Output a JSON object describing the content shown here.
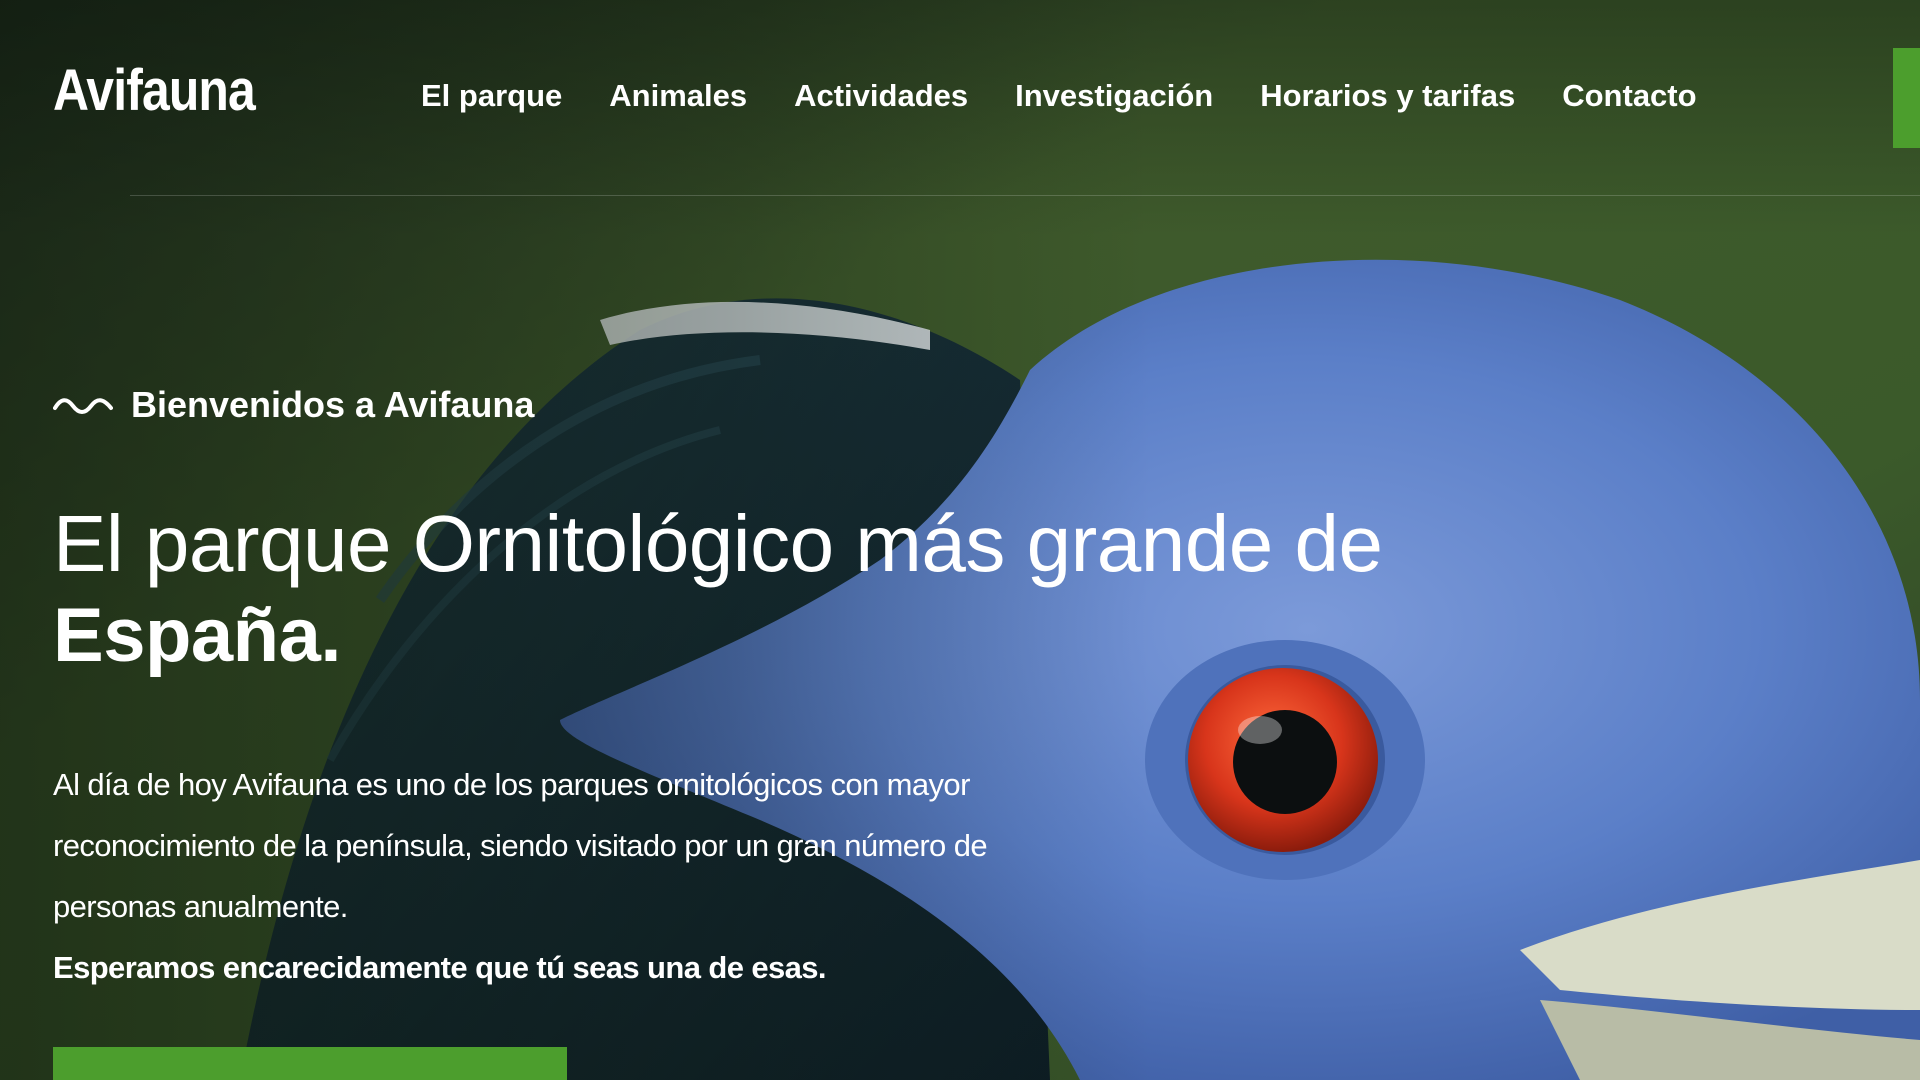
{
  "site": {
    "logo": "Avifauna"
  },
  "nav": {
    "items": [
      {
        "label": "El parque"
      },
      {
        "label": "Animales"
      },
      {
        "label": "Actividades"
      },
      {
        "label": "Investigación"
      },
      {
        "label": "Horarios y tarifas"
      },
      {
        "label": "Contacto"
      }
    ]
  },
  "hero": {
    "eyebrow": "Bienvenidos a Avifauna",
    "eyebrow_icon": "wave-icon",
    "title_line1": "El parque Ornitológico más grande de",
    "title_line2": "España.",
    "body_line1": "Al día de hoy Avifauna es uno de los parques ornitológicos con mayor",
    "body_line2": "reconocimiento de la península, siendo visitado por un gran número de",
    "body_line3": "personas anualmente.",
    "body_emphasis": "Esperamos encarecidamente que tú seas una de esas."
  },
  "colors": {
    "accent_green": "#4c9e2d",
    "text": "#ffffff",
    "background": "#24361f",
    "bird_blue": "#5b7fc8",
    "bird_eye": "#d8351b"
  }
}
